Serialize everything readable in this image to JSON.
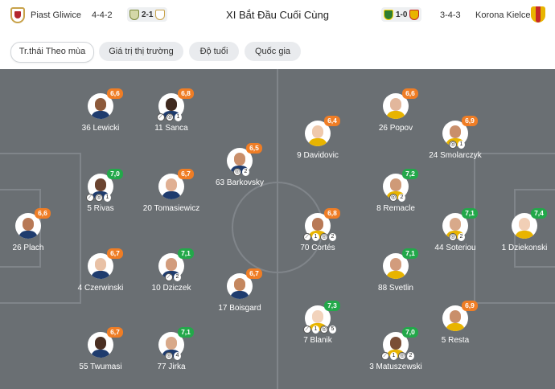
{
  "header": {
    "home_team": "Piast Gliwice",
    "home_formation": "4-4-2",
    "home_crest_color": "#c8a24a",
    "home_recent_score": "2-1",
    "title": "XI Bắt Đầu Cuối Cùng",
    "away_recent_score": "1-0",
    "away_formation": "3-4-3",
    "away_team": "Korona Kielce",
    "away_crest_color": "#e8b400"
  },
  "tabs": [
    {
      "label": "Tr.thái Theo mùa",
      "active": true
    },
    {
      "label": "Giá trị thị trường",
      "active": false
    },
    {
      "label": "Độ tuổi",
      "active": false
    },
    {
      "label": "Quốc gia",
      "active": false
    }
  ],
  "colors": {
    "pitch": "#6a6f73",
    "rating_orange": "#ef7d25",
    "rating_green": "#23a84a",
    "line": "#80858a"
  },
  "players": [
    {
      "name": "36 Lewicki",
      "rating": "6,6",
      "tier": "orange",
      "side": "home"
    },
    {
      "name": "11 Sanca",
      "rating": "6,8",
      "tier": "orange",
      "side": "home",
      "events": [
        {
          "icon": "boot-icon",
          "count": ""
        },
        {
          "icon": "ball-icon",
          "count": "1"
        }
      ]
    },
    {
      "name": "63 Barkovsky",
      "rating": "6,5",
      "tier": "orange",
      "side": "home",
      "events": [
        {
          "icon": "ball-icon",
          "count": "2"
        }
      ]
    },
    {
      "name": "5 Rivas",
      "rating": "7,0",
      "tier": "green",
      "side": "home",
      "events": [
        {
          "icon": "boot-icon",
          "count": ""
        },
        {
          "icon": "ball-icon",
          "count": "1"
        }
      ]
    },
    {
      "name": "20 Tomasiewicz",
      "rating": "6,7",
      "tier": "orange",
      "side": "home"
    },
    {
      "name": "26 Plach",
      "rating": "6,6",
      "tier": "orange",
      "side": "home"
    },
    {
      "name": "4 Czerwinski",
      "rating": "6,7",
      "tier": "orange",
      "side": "home"
    },
    {
      "name": "10 Dziczek",
      "rating": "7,1",
      "tier": "green",
      "side": "home",
      "events": [
        {
          "icon": "boot-icon",
          "count": "2"
        }
      ]
    },
    {
      "name": "17 Boisgard",
      "rating": "6,7",
      "tier": "orange",
      "side": "home"
    },
    {
      "name": "55 Twumasi",
      "rating": "6,7",
      "tier": "orange",
      "side": "home"
    },
    {
      "name": "77 Jirka",
      "rating": "7,1",
      "tier": "green",
      "side": "home",
      "events": [
        {
          "icon": "ball-icon",
          "count": "4"
        }
      ]
    },
    {
      "name": "26 Popov",
      "rating": "6,6",
      "tier": "orange",
      "side": "away"
    },
    {
      "name": "9 Davidovic",
      "rating": "6,4",
      "tier": "orange",
      "side": "away"
    },
    {
      "name": "24 Smolarczyk",
      "rating": "6,9",
      "tier": "orange",
      "side": "away",
      "events": [
        {
          "icon": "ball-icon",
          "count": "1"
        }
      ]
    },
    {
      "name": "8 Remacle",
      "rating": "7,2",
      "tier": "green",
      "side": "away",
      "events": [
        {
          "icon": "ball-icon",
          "count": "2"
        }
      ]
    },
    {
      "name": "70 Cortés",
      "rating": "6,8",
      "tier": "orange",
      "side": "away",
      "events": [
        {
          "icon": "boot-icon",
          "count": "1"
        },
        {
          "icon": "ball-icon",
          "count": "2"
        }
      ]
    },
    {
      "name": "44 Soteriou",
      "rating": "7,1",
      "tier": "green",
      "side": "away",
      "events": [
        {
          "icon": "ball-icon",
          "count": "2"
        }
      ]
    },
    {
      "name": "1 Dziekonski",
      "rating": "7,4",
      "tier": "green",
      "side": "away"
    },
    {
      "name": "88 Svetlin",
      "rating": "7,1",
      "tier": "green",
      "side": "away"
    },
    {
      "name": "7 Blanik",
      "rating": "7,3",
      "tier": "green",
      "side": "away",
      "events": [
        {
          "icon": "boot-icon",
          "count": "1"
        },
        {
          "icon": "ball-icon",
          "count": "5"
        }
      ]
    },
    {
      "name": "5 Resta",
      "rating": "6,9",
      "tier": "orange",
      "side": "away"
    },
    {
      "name": "3 Matuszewski",
      "rating": "7,0",
      "tier": "green",
      "side": "away",
      "events": [
        {
          "icon": "boot-icon",
          "count": "1"
        },
        {
          "icon": "ball-icon",
          "count": "2"
        }
      ]
    }
  ]
}
